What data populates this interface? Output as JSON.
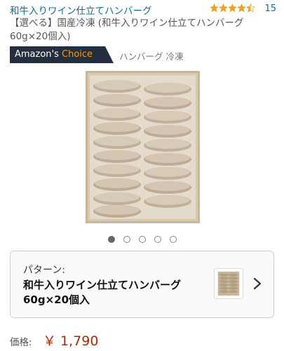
{
  "product": {
    "brand_link": "和牛入りワイン仕立てハンバーグ",
    "rating_stars": 4.5,
    "review_count": "15",
    "title": "【選べる】国産冷凍 (和牛入りワイン仕立てハンバーグ 60g×20個入)",
    "badge": {
      "prefix": "Amazon's ",
      "suffix": "Choice",
      "keywords": "ハンバーグ 冷凍"
    },
    "image_icon": "frozen-hamburg-box-image",
    "carousel": {
      "count": 5,
      "active_index": 0
    }
  },
  "variant": {
    "label": "パターン:",
    "value": "和牛入りワイン仕立てハンバーグ60g×20個入",
    "chevron_icon": "chevron-right-icon"
  },
  "price": {
    "label": "価格:",
    "value": "￥ 1,790"
  },
  "colors": {
    "link": "#0a6e9c",
    "price": "#b12704",
    "badge_bg": "#232f3e",
    "badge_accent": "#ff9900",
    "star": "#f0a41c"
  }
}
